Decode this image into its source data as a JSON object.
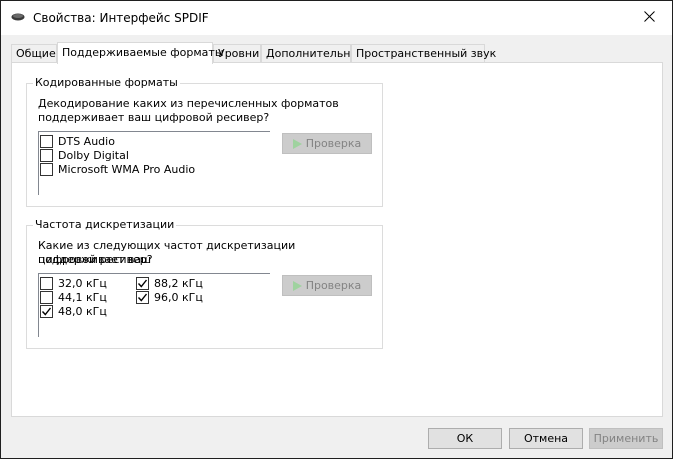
{
  "window": {
    "title": "Свойства: Интерфейс SPDIF"
  },
  "tabs": [
    {
      "label": "Общие",
      "active": false
    },
    {
      "label": "Поддерживаемые форматы",
      "active": true
    },
    {
      "label": "Уровни",
      "active": false
    },
    {
      "label": "Дополнительно",
      "active": false
    },
    {
      "label": "Пространственный звук",
      "active": false
    }
  ],
  "encoded": {
    "title": "Кодированные форматы",
    "question_line1": "Декодирование каких из перечисленных форматов",
    "question_line2": "поддерживает ваш цифровой ресивер?",
    "formats": [
      {
        "label": "DTS Audio",
        "checked": false
      },
      {
        "label": "Dolby Digital",
        "checked": false
      },
      {
        "label": "Microsoft WMA Pro Audio",
        "checked": false
      }
    ],
    "test_label": "Проверка"
  },
  "sample_rate": {
    "title": "Частота дискретизации",
    "question_line1": "Какие из следующих частот дискретизации поддерживает ваш",
    "question_line2": "цифровой ресивер?",
    "rates": [
      {
        "label": "32,0 кГц",
        "checked": false
      },
      {
        "label": "44,1 кГц",
        "checked": false
      },
      {
        "label": "48,0 кГц",
        "checked": true
      },
      {
        "label": "88,2 кГц",
        "checked": true
      },
      {
        "label": "96,0 кГц",
        "checked": true
      }
    ],
    "test_label": "Проверка"
  },
  "buttons": {
    "ok": "ОК",
    "cancel": "Отмена",
    "apply": "Применить"
  },
  "colors": {
    "play_icon": "#9fd29f",
    "disabled_text": "#838383"
  }
}
